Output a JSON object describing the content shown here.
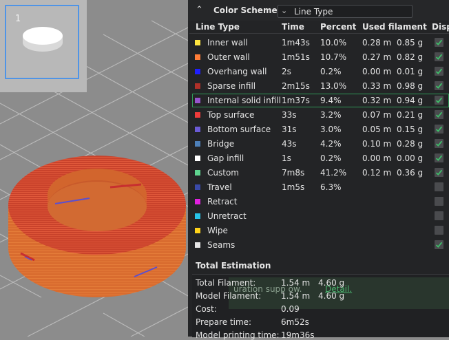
{
  "thumbnail": {
    "plate_number": "1"
  },
  "legend": {
    "scheme_label": "Color Scheme",
    "scheme_value": "Line Type",
    "columns": [
      "Line Type",
      "Time",
      "Percent",
      "Used filament",
      "Disp"
    ],
    "rows": [
      {
        "name": "Inner wall",
        "color": "#ffe640",
        "time": "1m43s",
        "percent": "10.0%",
        "length": "0.28 m",
        "weight": "0.85 g",
        "visible": true,
        "highlighted": false
      },
      {
        "name": "Outer wall",
        "color": "#ff7d38",
        "time": "1m51s",
        "percent": "10.7%",
        "length": "0.27 m",
        "weight": "0.82 g",
        "visible": true,
        "highlighted": false
      },
      {
        "name": "Overhang wall",
        "color": "#1f1fff",
        "time": "2s",
        "percent": "0.2%",
        "length": "0.00 m",
        "weight": "0.01 g",
        "visible": true,
        "highlighted": false
      },
      {
        "name": "Sparse infill",
        "color": "#b03029",
        "time": "2m15s",
        "percent": "13.0%",
        "length": "0.33 m",
        "weight": "0.98 g",
        "visible": true,
        "highlighted": false
      },
      {
        "name": "Internal solid infill",
        "color": "#9654cc",
        "time": "1m37s",
        "percent": "9.4%",
        "length": "0.32 m",
        "weight": "0.94 g",
        "visible": true,
        "highlighted": true
      },
      {
        "name": "Top surface",
        "color": "#f03b3b",
        "time": "33s",
        "percent": "3.2%",
        "length": "0.07 m",
        "weight": "0.21 g",
        "visible": true,
        "highlighted": false
      },
      {
        "name": "Bottom surface",
        "color": "#6b5bd6",
        "time": "31s",
        "percent": "3.0%",
        "length": "0.05 m",
        "weight": "0.15 g",
        "visible": true,
        "highlighted": false
      },
      {
        "name": "Bridge",
        "color": "#4d80ba",
        "time": "43s",
        "percent": "4.2%",
        "length": "0.10 m",
        "weight": "0.28 g",
        "visible": true,
        "highlighted": false
      },
      {
        "name": "Gap infill",
        "color": "#ffffff",
        "time": "1s",
        "percent": "0.2%",
        "length": "0.00 m",
        "weight": "0.00 g",
        "visible": true,
        "highlighted": false
      },
      {
        "name": "Custom",
        "color": "#5ed48f",
        "time": "7m8s",
        "percent": "41.2%",
        "length": "0.12 m",
        "weight": "0.36 g",
        "visible": true,
        "highlighted": false
      },
      {
        "name": "Travel",
        "color": "#3a4aa8",
        "time": "1m5s",
        "percent": "6.3%",
        "length": "",
        "weight": "",
        "visible": false,
        "highlighted": false
      },
      {
        "name": "Retract",
        "color": "#e020e0",
        "time": "",
        "percent": "",
        "length": "",
        "weight": "",
        "visible": false,
        "highlighted": false
      },
      {
        "name": "Unretract",
        "color": "#27c3e8",
        "time": "",
        "percent": "",
        "length": "",
        "weight": "",
        "visible": false,
        "highlighted": false
      },
      {
        "name": "Wipe",
        "color": "#ffd31a",
        "time": "",
        "percent": "",
        "length": "",
        "weight": "",
        "visible": false,
        "highlighted": false
      },
      {
        "name": "Seams",
        "color": "#e6e6e6",
        "time": "",
        "percent": "",
        "length": "",
        "weight": "",
        "visible": true,
        "highlighted": false
      }
    ]
  },
  "estimation": {
    "title": "Total Estimation",
    "rows": [
      {
        "label": "Total Filament:",
        "value": "1.54 m",
        "value2": "4.60 g"
      },
      {
        "label": "Model Filament:",
        "value": "1.54 m",
        "value2": "4.60 g"
      },
      {
        "label": "Cost:",
        "value": "0.09",
        "value2": ""
      },
      {
        "label": "Prepare time:",
        "value": "6m52s",
        "value2": ""
      },
      {
        "label": "Model printing time:",
        "value": "19m36s",
        "value2": ""
      }
    ]
  },
  "notification": {
    "text": "uration  supp   ow.",
    "link": "Detail."
  },
  "colors": {
    "panel_bg": "#232426",
    "accent_green": "#2f9a57",
    "model_orange": "#d9692e",
    "model_red": "#c8412a",
    "selection_blue": "#4f94e6"
  }
}
